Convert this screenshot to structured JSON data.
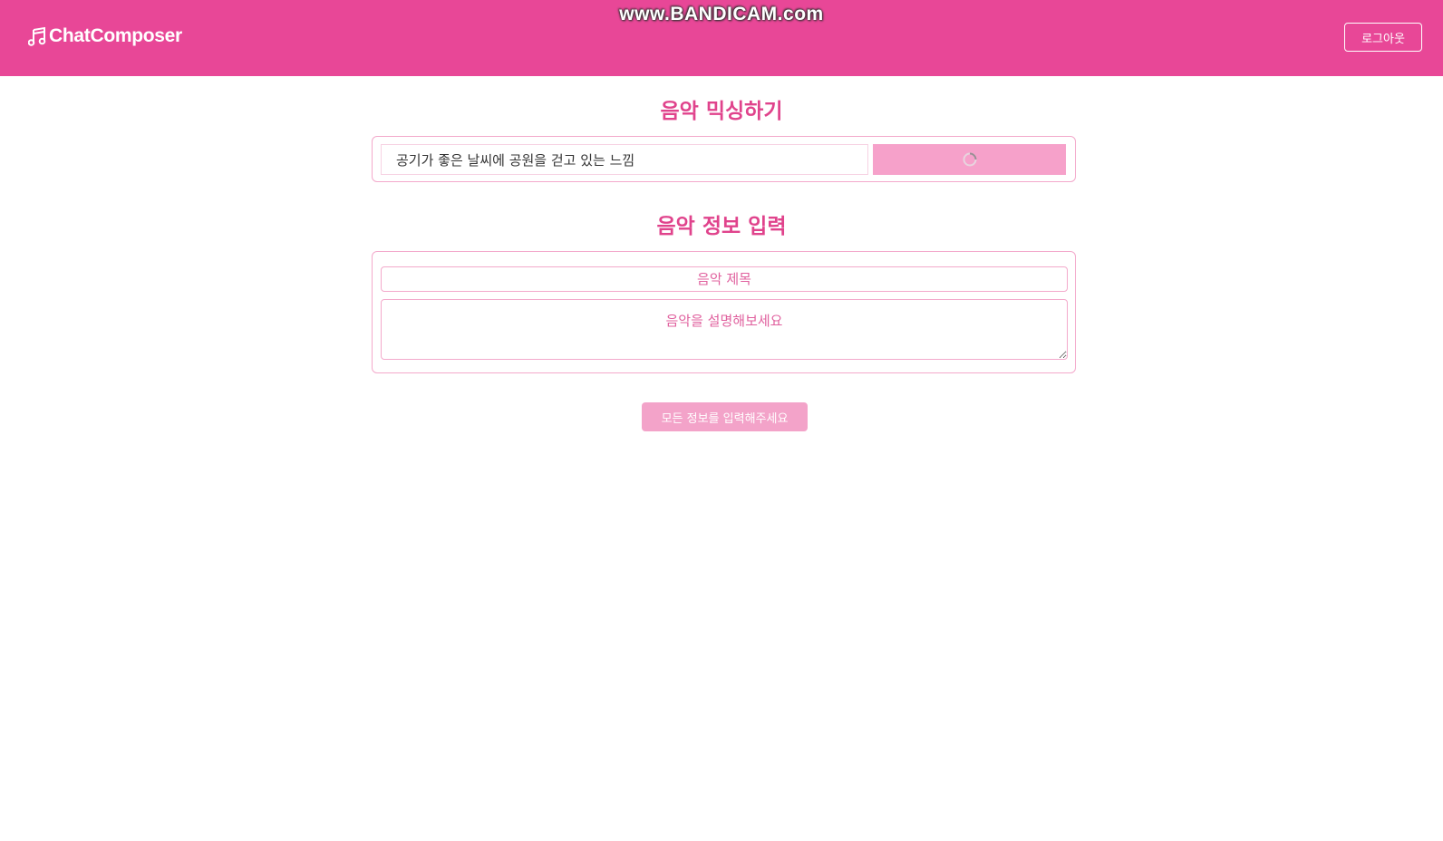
{
  "header": {
    "logo_text": "ChatComposer",
    "logo_icon": "music-note-icon",
    "logout_label": "로그아웃",
    "background_color": "#e84797"
  },
  "watermark": {
    "text": "www.BANDICAM.com"
  },
  "mix_section": {
    "title": "음악 믹싱하기",
    "input_value": "공기가 좋은 날씨에 공원을 걷고 있는 느낌",
    "button_state": "loading",
    "button_icon": "spinner-icon"
  },
  "info_section": {
    "title": "음악 정보 입력",
    "title_placeholder": "음악 제목",
    "description_placeholder": "음악을 설명해보세요"
  },
  "submit": {
    "label": "모든 정보를 입력해주세요",
    "disabled": true
  },
  "colors": {
    "accent": "#e0438c",
    "border": "#f3a9cb",
    "button_disabled": "#f3a3c9"
  }
}
